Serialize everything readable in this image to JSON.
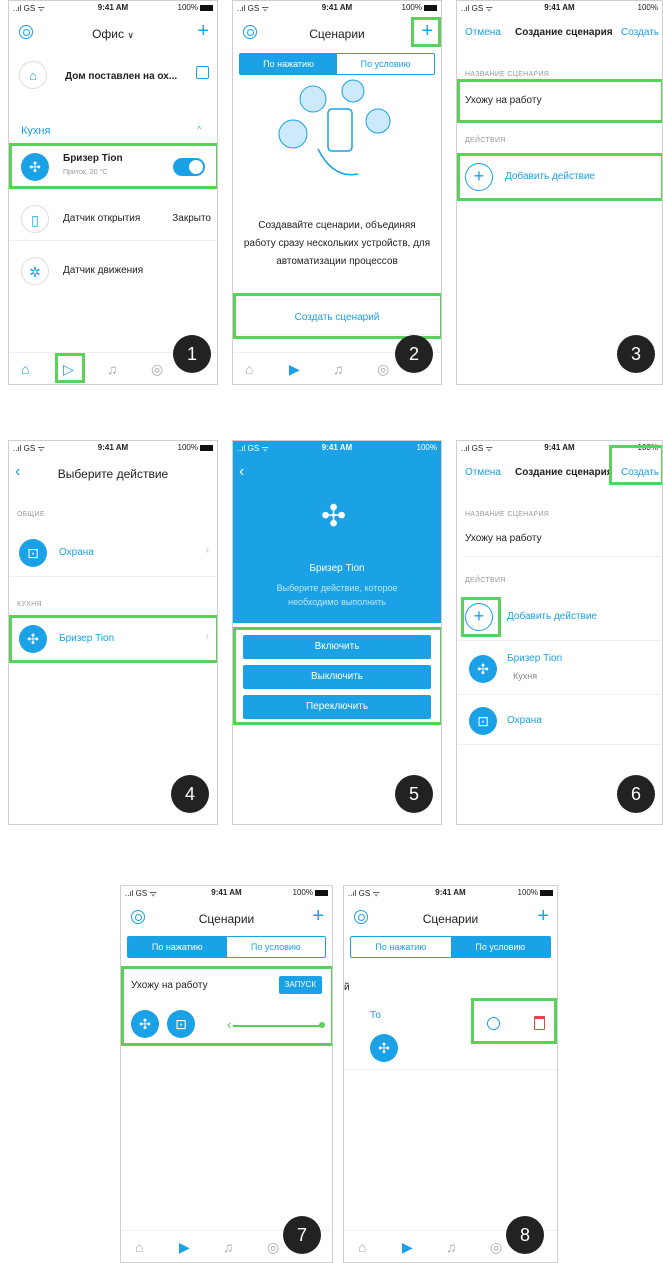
{
  "status": {
    "carrier": "..ıl GS ᯤ",
    "time": "9:41 AM",
    "battery": "100%"
  },
  "colors": {
    "accent": "#1aa1e6",
    "highlight": "#5ad15a",
    "delete": "#e04848"
  },
  "p1": {
    "title": "Офис",
    "security_row": "Дом поставлен на ох...",
    "room": "Кухня",
    "device_name": "Бризер Tion",
    "device_sub": "Приток, 20 °C",
    "sensor_open": "Датчик открытия",
    "sensor_open_state": "Закрыто",
    "sensor_motion": "Датчик движения",
    "badge": "1"
  },
  "p2": {
    "title": "Сценарии",
    "tab_press": "По нажатию",
    "tab_condition": "По условию",
    "description": "Создавайте сценарии, объединяя работу сразу нескольких устройств, для автоматизации процессов",
    "create_label": "Создать сценарий",
    "badge": "2"
  },
  "p3": {
    "cancel": "Отмена",
    "title": "Создание сценария",
    "create": "Создать",
    "name_section": "НАЗВАНИЕ СЦЕНАРИЯ",
    "name_value": "Ухожу на работу",
    "actions_section": "ДЕЙСТВИЯ",
    "add_action": "Добавить действие",
    "badge": "3"
  },
  "p4": {
    "title": "Выберите действие",
    "general_section": "ОБЩИЕ",
    "security_item": "Охрана",
    "kitchen_section": "КУХНЯ",
    "breezer_item": "Бризер Tion",
    "badge": "4"
  },
  "p5": {
    "device_name": "Бризер Tion",
    "hint": "Выберите действие, которое необходимо выполнить",
    "btn_on": "Включить",
    "btn_off": "Выключить",
    "btn_toggle": "Переключить",
    "badge": "5"
  },
  "p6": {
    "cancel": "Отмена",
    "title": "Создание сценария",
    "create": "Создать",
    "name_section": "НАЗВАНИЕ СЦЕНАРИЯ",
    "name_value": "Ухожу на работу",
    "actions_section": "ДЕЙСТВИЯ",
    "add_action": "Добавить действие",
    "action1_name": "Бризер Tion",
    "action1_room": "Кухня",
    "action2_name": "Охрана",
    "badge": "6"
  },
  "p7": {
    "title": "Сценарии",
    "tab_press": "По нажатию",
    "tab_condition": "По условию",
    "scenario_name": "Ухожу на работу",
    "run_label": "ЗАПУСК",
    "badge": "7"
  },
  "p8": {
    "title": "Сценарии",
    "tab_press": "По нажатию",
    "tab_condition": "По условию",
    "to_label": "То",
    "stray_char": "й",
    "badge": "8"
  }
}
